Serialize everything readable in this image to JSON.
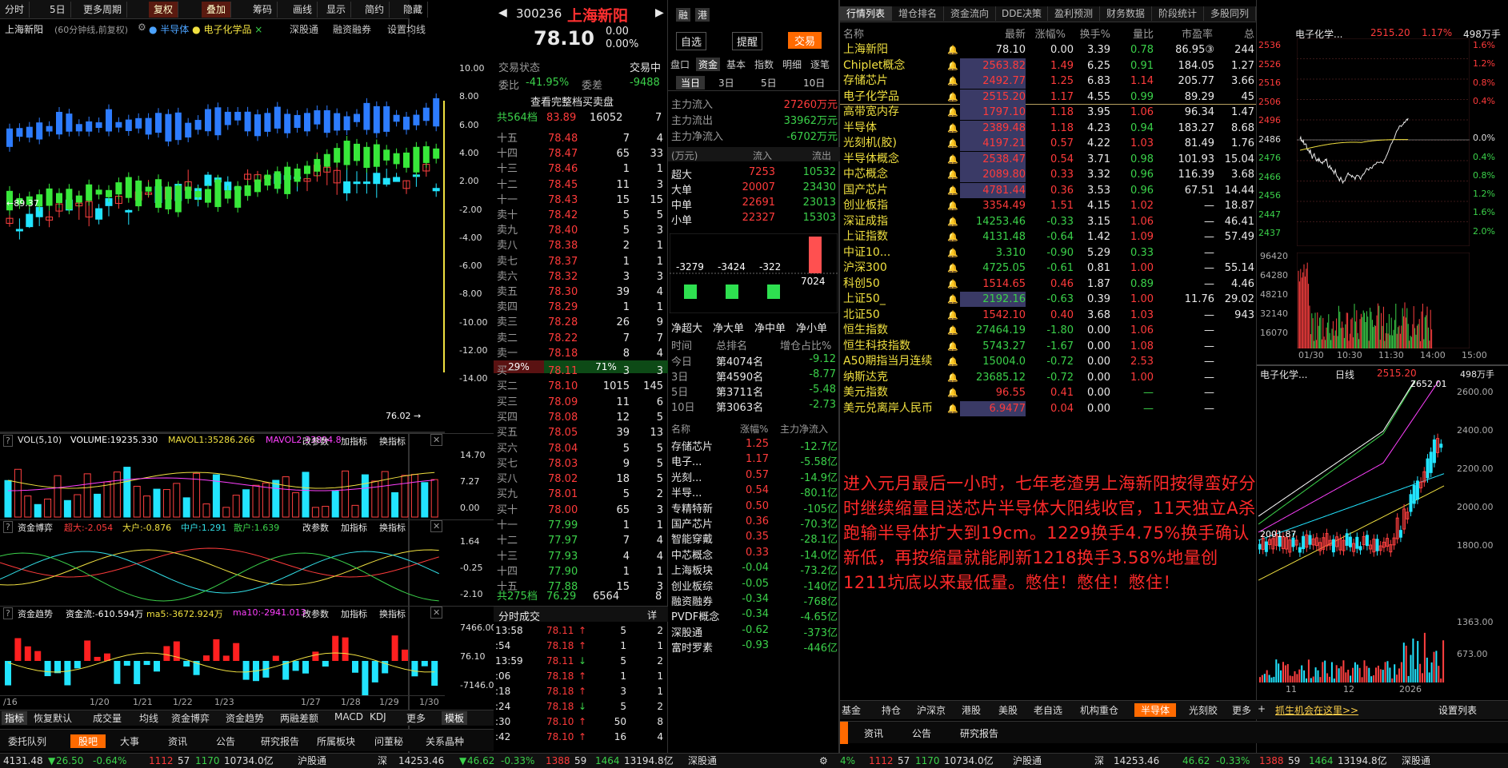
{
  "toolbar": {
    "items": [
      "分时",
      "5日",
      "更多周期",
      "复权",
      "叠加",
      "筹码",
      "画线",
      "显示",
      "简约",
      "隐藏"
    ]
  },
  "chart": {
    "stock": "上海新阳",
    "period": "(60分钟线,前复权)",
    "overlay1": "半导体",
    "overlay2": "电子化学品",
    "links": [
      "深股通",
      "融资融券",
      "设置均线"
    ],
    "yticks": [
      "10.00",
      "8.00",
      "6.00",
      "4.00",
      "2.00",
      "-2.00",
      "-4.00",
      "-6.00",
      "-8.00",
      "-10.00",
      "-12.00",
      "-14.00"
    ],
    "high_label": "←89.37",
    "low_label": "76.02 →",
    "vol_label": "VOL(5,10)",
    "vol_text": "VOLUME:19235.330",
    "mavol1": "MAVOL1:35286.266",
    "mavol2": "MAVOL2:33894.8",
    "vol_ticks": [
      "14.70",
      "7.27",
      "0.00"
    ],
    "cap_label": "资金博弈",
    "cap_a": "超大:-2.054",
    "cap_b": "大户:-0.876",
    "cap_c": "中户:1.291",
    "cap_d": "散户:1.639",
    "cap_ticks": [
      "1.64",
      "-0.25",
      "-2.10"
    ],
    "trend_label": "资金趋势",
    "trend_a": "资金流:-610.594万",
    "trend_b": "ma5:-3672.924万",
    "trend_c": "ma10:-2941.013",
    "trend_ticks": [
      "7466.00",
      "76.10",
      "-7146.00"
    ],
    "actions": [
      "改参数",
      "加指标",
      "换指标"
    ],
    "dates": [
      "/16",
      "1/20",
      "1/21",
      "1/22",
      "1/23",
      "1/27",
      "1/28",
      "1/29",
      "1/30"
    ],
    "bottom_tabs": [
      "指标",
      "恢复默认",
      "成交量",
      "均线",
      "资金博弈",
      "资金趋势",
      "两融差额",
      "MACD",
      "KDJ",
      "更多",
      "模板"
    ],
    "news_tabs": [
      "委托队列",
      "股吧",
      "大事",
      "资讯",
      "公告",
      "研究报告",
      "所属板块",
      "问董秘",
      "关系晶种"
    ]
  },
  "quote": {
    "code": "300236",
    "name": "上海新阳",
    "price": "78.10",
    "chg": "0.00",
    "pct": "0.00%",
    "btn1": "自选",
    "btn2": "提醒",
    "btn3": "交易",
    "status_label": "交易状态",
    "status": "交易中",
    "wb_label": "委比",
    "wb": "-41.95%",
    "wc_label": "委差",
    "wc": "-9488",
    "full_btn": "查看完整档买卖盘",
    "total_sell": "共564档",
    "total_sell_price": "83.89",
    "total_sell_vol": "16052",
    "total_sell_n": "7",
    "sells": [
      [
        "十五",
        "78.48",
        "7",
        "4"
      ],
      [
        "十四",
        "78.47",
        "65",
        "33"
      ],
      [
        "十三",
        "78.46",
        "1",
        "1"
      ],
      [
        "十二",
        "78.45",
        "11",
        "3"
      ],
      [
        "十一",
        "78.43",
        "15",
        "15"
      ],
      [
        "卖十",
        "78.42",
        "5",
        "5"
      ],
      [
        "卖九",
        "78.40",
        "5",
        "3"
      ],
      [
        "卖八",
        "78.38",
        "2",
        "1"
      ],
      [
        "卖七",
        "78.37",
        "1",
        "1"
      ],
      [
        "卖六",
        "78.32",
        "3",
        "3"
      ],
      [
        "卖五",
        "78.30",
        "39",
        "4"
      ],
      [
        "卖四",
        "78.29",
        "1",
        "1"
      ],
      [
        "卖三",
        "78.28",
        "26",
        "9"
      ],
      [
        "卖二",
        "78.22",
        "7",
        "7"
      ],
      [
        "卖一",
        "78.18",
        "8",
        "4"
      ]
    ],
    "ratio_left": "29%",
    "ratio_right": "71%",
    "buys": [
      [
        "买一",
        "78.11",
        "3",
        "3"
      ],
      [
        "买二",
        "78.10",
        "1015",
        "145"
      ],
      [
        "买三",
        "78.09",
        "11",
        "6"
      ],
      [
        "买四",
        "78.08",
        "12",
        "5"
      ],
      [
        "买五",
        "78.05",
        "39",
        "13"
      ],
      [
        "买六",
        "78.04",
        "5",
        "5"
      ],
      [
        "买七",
        "78.03",
        "9",
        "5"
      ],
      [
        "买八",
        "78.02",
        "18",
        "5"
      ],
      [
        "买九",
        "78.01",
        "5",
        "2"
      ],
      [
        "买十",
        "78.00",
        "65",
        "3"
      ],
      [
        "十一",
        "77.99",
        "1",
        "1"
      ],
      [
        "十二",
        "77.97",
        "7",
        "4"
      ],
      [
        "十三",
        "77.93",
        "4",
        "4"
      ],
      [
        "十四",
        "77.90",
        "1",
        "1"
      ],
      [
        "十五",
        "77.88",
        "15",
        "3"
      ]
    ],
    "total_buy": "共275档",
    "total_buy_price": "76.29",
    "total_buy_vol": "6564",
    "total_buy_n": "8",
    "ticks_title": "分时成交",
    "ticks_btn": "详",
    "ticks": [
      [
        "13:58",
        "78.11",
        "5",
        "2"
      ],
      [
        ":54",
        "78.18",
        "1",
        "1"
      ],
      [
        "13:59",
        "78.11",
        "5",
        "2"
      ],
      [
        ":06",
        "78.18",
        "1",
        "1"
      ],
      [
        ":18",
        "78.18",
        "3",
        "1"
      ],
      [
        ":24",
        "78.18",
        "5",
        "2"
      ],
      [
        ":30",
        "78.10",
        "50",
        "8"
      ],
      [
        ":42",
        "78.10",
        "16",
        "4"
      ]
    ]
  },
  "flow": {
    "tabs": [
      "盘口",
      "资金",
      "基本",
      "指数",
      "明细",
      "逐笔"
    ],
    "periods": [
      "当日",
      "3日",
      "5日",
      "10日"
    ],
    "main_in_label": "主力流入",
    "main_in": "27260万元",
    "main_out_label": "主力流出",
    "main_out": "33962万元",
    "main_net_label": "主力净流入",
    "main_net": "-6702万元",
    "unit": "(万元)",
    "in_h": "流入",
    "out_h": "流出",
    "rows": [
      [
        "超大",
        "7253",
        "10532"
      ],
      [
        "大单",
        "20007",
        "23430"
      ],
      [
        "中单",
        "22691",
        "23013"
      ],
      [
        "小单",
        "22327",
        "15303"
      ]
    ],
    "bars": [
      {
        "v": -3279,
        "l": "-3279"
      },
      {
        "v": -3424,
        "l": "-3424"
      },
      {
        "v": -322,
        "l": "-322"
      },
      {
        "v": 7024,
        "l": "7024"
      }
    ],
    "bar_labels": [
      "净超大",
      "净大单",
      "净中单",
      "净小单"
    ],
    "rank_h": [
      "时间",
      "总排名",
      "增仓占比%"
    ],
    "ranks": [
      [
        "今日",
        "第4074名",
        "-9.12"
      ],
      [
        "3日",
        "第4590名",
        "-8.77"
      ],
      [
        "5日",
        "第3711名",
        "-5.48"
      ],
      [
        "10日",
        "第3063名",
        "-2.73"
      ]
    ],
    "sector_h": [
      "名称",
      "涨幅%",
      "主力净流入"
    ],
    "sectors": [
      [
        "存储芯片",
        "1.25",
        "-12.7亿"
      ],
      [
        "电子...",
        "1.17",
        "-5.58亿"
      ],
      [
        "光刻...",
        "0.57",
        "-14.9亿"
      ],
      [
        "半导...",
        "0.54",
        "-80.1亿"
      ],
      [
        "专精特新",
        "0.50",
        "-105亿"
      ],
      [
        "国产芯片",
        "0.36",
        "-70.3亿"
      ],
      [
        "智能穿戴",
        "0.35",
        "-28.1亿"
      ],
      [
        "中芯概念",
        "0.33",
        "-14.0亿"
      ],
      [
        "上海板块",
        "-0.04",
        "-73.2亿"
      ],
      [
        "创业板综",
        "-0.05",
        "-140亿"
      ],
      [
        "融资融券",
        "-0.34",
        "-768亿"
      ],
      [
        "PVDF概念",
        "-0.34",
        "-4.65亿"
      ],
      [
        "深股通",
        "-0.62",
        "-373亿"
      ],
      [
        "富时罗素",
        "-0.93",
        "-446亿"
      ]
    ]
  },
  "list": {
    "tabs": [
      "行情列表",
      "增仓排名",
      "资金流向",
      "DDE决策",
      "盈利预测",
      "财务数据",
      "阶段统计",
      "多股同列"
    ],
    "headers": [
      "名称",
      "最新",
      "涨幅%",
      "换手%",
      "量比",
      "市盈率",
      "总"
    ],
    "rows": [
      [
        "上海新阳",
        "78.10",
        "0.00",
        "3.39",
        "0.78",
        "86.95③",
        "244"
      ],
      [
        "Chiplet概念",
        "2563.82",
        "1.49",
        "6.25",
        "0.91",
        "184.05",
        "1.27"
      ],
      [
        "存储芯片",
        "2492.77",
        "1.25",
        "6.83",
        "1.14",
        "205.77",
        "3.66"
      ],
      [
        "电子化学品",
        "2515.20",
        "1.17",
        "4.55",
        "0.99",
        "89.29",
        "45"
      ],
      [
        "高带宽内存",
        "1797.10",
        "1.18",
        "3.95",
        "1.06",
        "96.34",
        "1.47"
      ],
      [
        "半导体",
        "2389.48",
        "1.18",
        "4.23",
        "0.94",
        "183.27",
        "8.68"
      ],
      [
        "光刻机(胶)",
        "4197.21",
        "0.57",
        "4.22",
        "1.03",
        "81.49",
        "1.76"
      ],
      [
        "半导体概念",
        "2538.47",
        "0.54",
        "3.71",
        "0.98",
        "101.93",
        "15.04"
      ],
      [
        "中芯概念",
        "2089.80",
        "0.33",
        "3.32",
        "0.96",
        "116.39",
        "3.68"
      ],
      [
        "国产芯片",
        "4781.44",
        "0.36",
        "3.53",
        "0.96",
        "67.51",
        "14.44"
      ],
      [
        "创业板指",
        "3354.49",
        "1.51",
        "4.15",
        "1.02",
        "—",
        "18.87"
      ],
      [
        "深证成指",
        "14253.46",
        "-0.33",
        "3.15",
        "1.06",
        "—",
        "46.41"
      ],
      [
        "上证指数",
        "4131.48",
        "-0.64",
        "1.42",
        "1.09",
        "—",
        "57.49"
      ],
      [
        "中证10...",
        "3.310",
        "-0.90",
        "5.29",
        "0.33",
        "—",
        ""
      ],
      [
        "沪深300",
        "4725.05",
        "-0.61",
        "0.81",
        "1.00",
        "—",
        "55.14"
      ],
      [
        "科创50",
        "1514.65",
        "0.46",
        "1.87",
        "0.89",
        "—",
        "4.46"
      ],
      [
        "上证50_",
        "2192.16",
        "-0.63",
        "0.39",
        "1.00",
        "11.76",
        "29.02"
      ],
      [
        "北证50",
        "1542.10",
        "0.40",
        "3.68",
        "1.03",
        "—",
        "943"
      ],
      [
        "恒生指数",
        "27464.19",
        "-1.80",
        "0.00",
        "1.06",
        "—",
        ""
      ],
      [
        "恒生科技指数",
        "5743.27",
        "-1.67",
        "0.00",
        "1.08",
        "—",
        ""
      ],
      [
        "A50期指当月连续",
        "15004.0",
        "-0.72",
        "0.00",
        "2.53",
        "—",
        ""
      ],
      [
        "纳斯达克",
        "23685.12",
        "-0.72",
        "0.00",
        "1.00",
        "—",
        ""
      ],
      [
        "美元指数",
        "96.55",
        "0.41",
        "0.00",
        "—",
        "—",
        ""
      ],
      [
        "美元兑离岸人民币",
        "6.9477",
        "0.04",
        "0.00",
        "—",
        "—",
        ""
      ]
    ],
    "note": "进入元月最后一小时，七年老渣男上海新阳按得蛮好分时继续缩量目送芯片半导体大阳线收官，11天独立A杀跑输半导体扩大到19cm。1229换手4.75%换手确认新低，再按缩量就能刷新1218换手3.58%地量创1211坑底以来最低量。憋住！憋住！憋住！",
    "bottom_tabs": [
      "基金",
      "持仓",
      "沪深京",
      "港股",
      "美股",
      "老自选",
      "机构重仓",
      "半导体",
      "光刻胶",
      "更多"
    ],
    "bottom_link": "抓生机会在这里>>",
    "settings": "设置列表",
    "sub_tabs": [
      "资讯",
      "公告",
      "研究报告"
    ]
  },
  "mini": {
    "title": "电子化学...",
    "price": "2515.20",
    "pct": "1.17%",
    "vol": "498万手",
    "yl": [
      "2536",
      "2526",
      "2516",
      "2506",
      "2496",
      "2486",
      "2476",
      "2466",
      "2456",
      "2447",
      "2437"
    ],
    "yr": [
      "1.6%",
      "1.2%",
      "0.8%",
      "0.4%",
      "0.0%",
      "0.4%",
      "0.8%",
      "1.2%",
      "1.6%",
      "2.0%"
    ],
    "vol_ticks": [
      "96420",
      "64280",
      "48210",
      "32140",
      "16070"
    ],
    "times": [
      "10:30",
      "11:30",
      "14:00",
      "15:00"
    ],
    "first_time": "01/30",
    "day_title": "电子化学...",
    "day_label": "日线",
    "day_price": "2515.20",
    "day_vol": "498万手",
    "day_high": "2652.01",
    "day_low": "2001.87",
    "day_yticks": [
      "2600.00",
      "2400.00",
      "2200.00",
      "2000.00",
      "1800.00"
    ],
    "day_vticks": [
      "1363.00",
      "673.00"
    ],
    "day_dates": [
      "11",
      "12",
      "2026"
    ]
  },
  "status": {
    "sh": "4131.48",
    "sh_chg": "26.50",
    "sh_pct": "-0.64%",
    "sh_up": "1112",
    "sh_flat": "57",
    "sh_down": "1170",
    "sh_amt": "10734.0亿",
    "hgt": "沪股通",
    "sz_label": "深",
    "sz": "14253.46",
    "sz_chg": "46.62",
    "sz_pct": "-0.33%",
    "sz_up": "1388",
    "sz_flat": "59",
    "sz_down": "1464",
    "sz_amt": "13194.8亿",
    "sgt": "深股通",
    "left_frag": "4%",
    "left_up": "1112",
    "left_flat": "57",
    "left_down": "1170",
    "left_amt": "10734.0亿",
    "right_frag": "深股通"
  }
}
